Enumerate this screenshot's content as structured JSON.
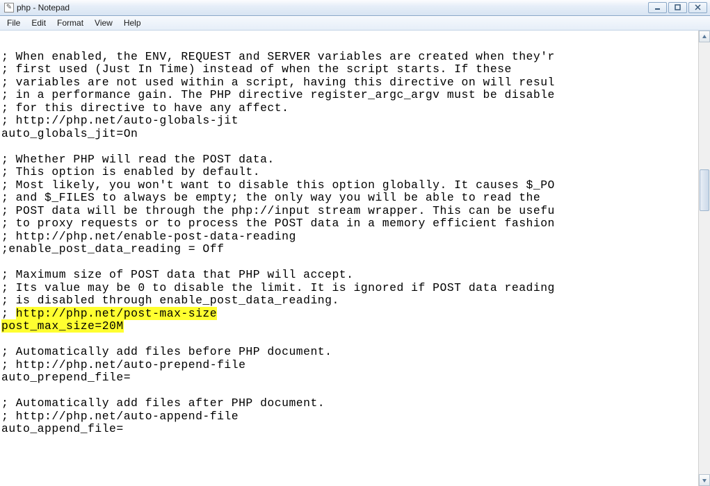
{
  "window": {
    "title": "php - Notepad"
  },
  "menu": {
    "file": "File",
    "edit": "Edit",
    "format": "Format",
    "view": "View",
    "help": "Help"
  },
  "editor": {
    "lines": [
      "",
      "; When enabled, the ENV, REQUEST and SERVER variables are created when they'r",
      "; first used (Just In Time) instead of when the script starts. If these",
      "; variables are not used within a script, having this directive on will resul",
      "; in a performance gain. The PHP directive register_argc_argv must be disable",
      "; for this directive to have any affect.",
      "; http://php.net/auto-globals-jit",
      "auto_globals_jit=On",
      "",
      "; Whether PHP will read the POST data.",
      "; This option is enabled by default.",
      "; Most likely, you won't want to disable this option globally. It causes $_PO",
      "; and $_FILES to always be empty; the only way you will be able to read the",
      "; POST data will be through the php://input stream wrapper. This can be usefu",
      "; to proxy requests or to process the POST data in a memory efficient fashion",
      "; http://php.net/enable-post-data-reading",
      ";enable_post_data_reading = Off",
      "",
      "; Maximum size of POST data that PHP will accept.",
      "; Its value may be 0 to disable the limit. It is ignored if POST data reading",
      "; is disabled through enable_post_data_reading.",
      "; http://php.net/post-max-size",
      "post_max_size=20M",
      "",
      "; Automatically add files before PHP document.",
      "; http://php.net/auto-prepend-file",
      "auto_prepend_file=",
      "",
      "; Automatically add files after PHP document.",
      "; http://php.net/auto-append-file",
      "auto_append_file="
    ],
    "highlight_prefix0": "; ",
    "highlight_text0": "http://php.net/post-max-size",
    "highlight_text1": "post_max_size=20M"
  }
}
